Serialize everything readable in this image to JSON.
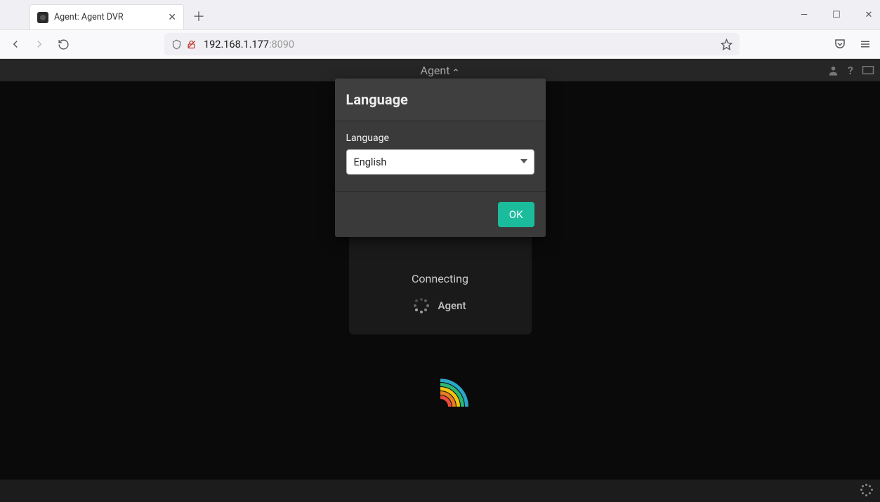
{
  "browser": {
    "tab_title": "Agent: Agent DVR",
    "url_host": "192.168.1.177",
    "url_port": ":8090"
  },
  "app": {
    "brand": "Agent",
    "status_title": "Connecting",
    "status_label": "Agent"
  },
  "modal": {
    "title": "Language",
    "field_label": "Language",
    "selected": "English",
    "ok_label": "OK"
  }
}
